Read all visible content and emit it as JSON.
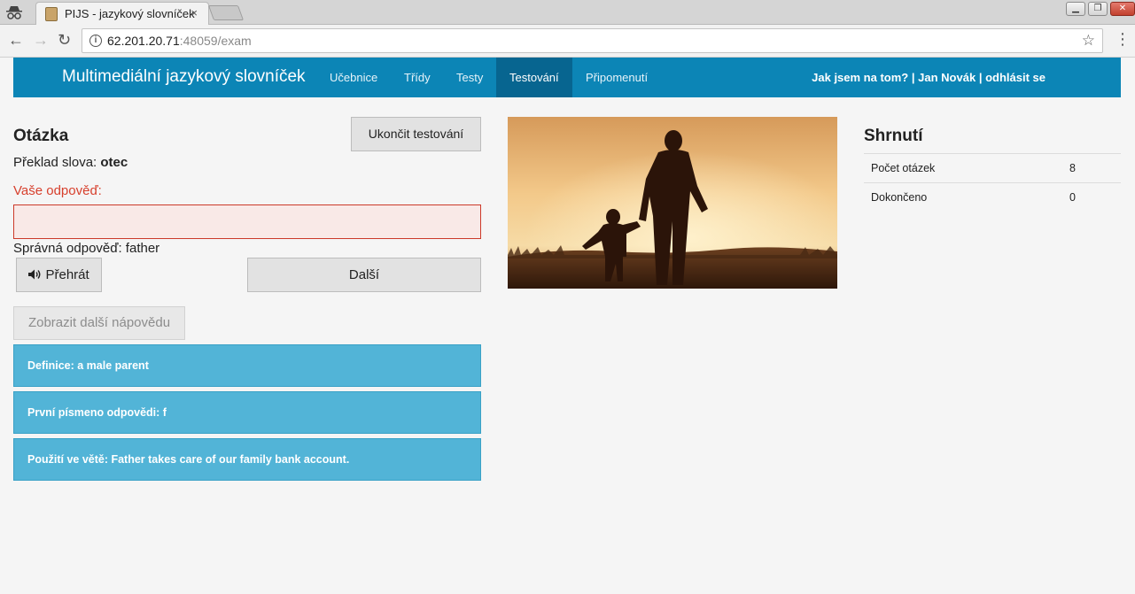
{
  "browser": {
    "tab_title": "PIJS - jazykový slovníček",
    "tab_close": "×",
    "url_host": "62.201.20.71",
    "url_rest": ":48059/exam"
  },
  "site": {
    "brand": "Multimediální jazykový slovníček",
    "nav": [
      {
        "label": "Učebnice"
      },
      {
        "label": "Třídy"
      },
      {
        "label": "Testy"
      },
      {
        "label": "Testování",
        "active": true
      },
      {
        "label": "Připomenutí"
      }
    ],
    "user_links": {
      "progress": "Jak jsem na tom?",
      "sep": "|",
      "user": "Jan Novák",
      "logout": "odhlásit se"
    },
    "accent_color": "#0c85b6"
  },
  "question": {
    "title": "Otázka",
    "end_button": "Ukončit testování",
    "translate_prefix": "Překlad slova: ",
    "word": "otec",
    "answer_label": "Vaše odpověď:",
    "answer_value": "",
    "correct_answer": "Správná odpověď: father",
    "play_button": "Přehrát",
    "play_icon": "speaker-icon",
    "next_button": "Další",
    "hint_button": "Zobrazit další nápovědu",
    "hints": [
      "Definice: a male parent",
      "První písmeno odpovědi: f",
      "Použití ve větě: Father takes care of our family bank account."
    ]
  },
  "summary": {
    "title": "Shrnutí",
    "rows": [
      {
        "label": "Počet otázek",
        "value": "8"
      },
      {
        "label": "Dokončeno",
        "value": "0"
      }
    ]
  }
}
